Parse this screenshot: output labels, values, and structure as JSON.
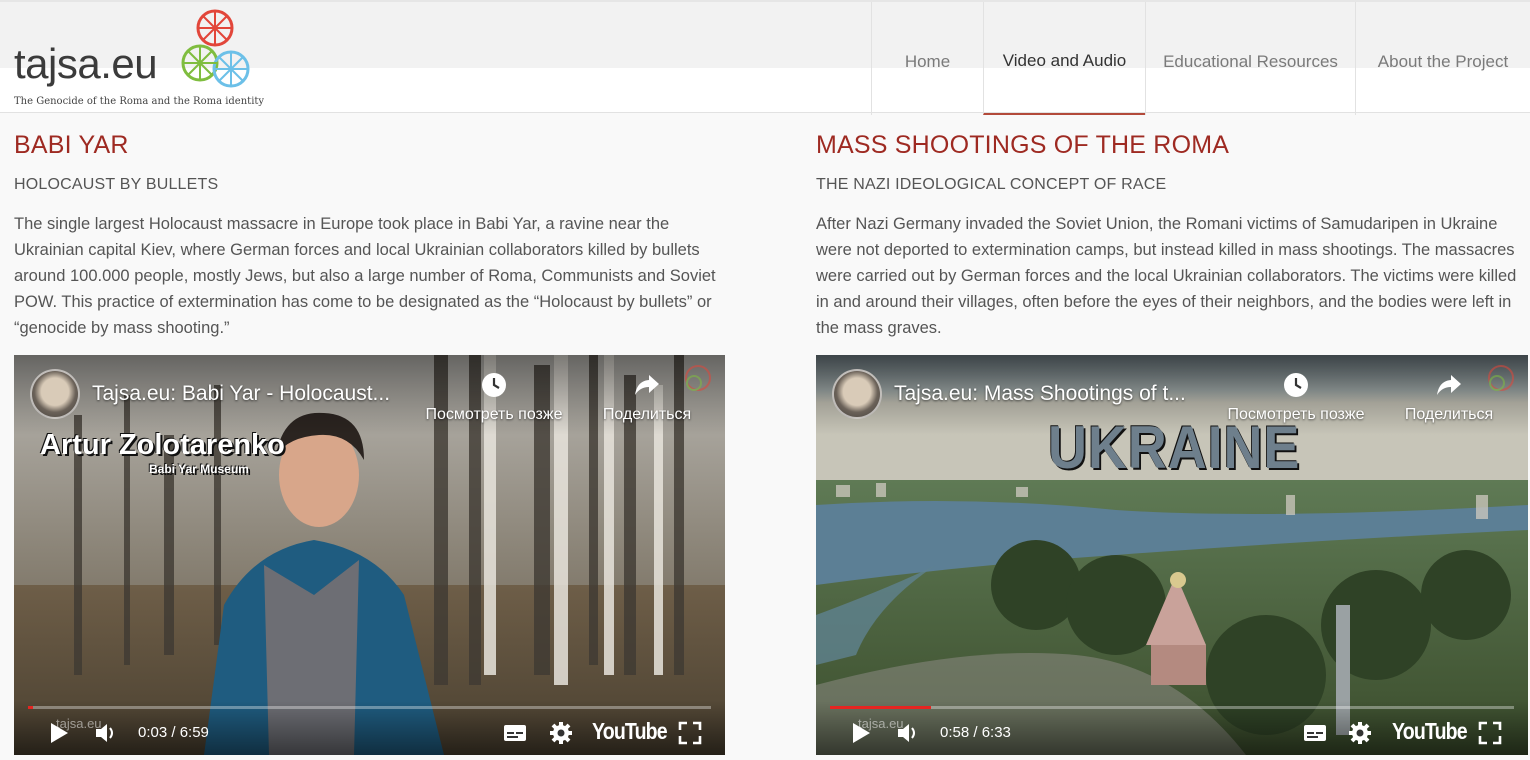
{
  "header": {
    "logo_text": "tajsa.eu",
    "logo_tagline": "The Genocide of the Roma and the Roma identity",
    "nav": [
      {
        "label": "Home",
        "active": false
      },
      {
        "label": "Video and Audio",
        "active": true
      },
      {
        "label": "Educational Resources",
        "active": false
      },
      {
        "label": "About the Project",
        "active": false
      }
    ]
  },
  "sections": [
    {
      "title": "BABI YAR",
      "subtitle": "HOLOCAUST BY BULLETS",
      "description": "The single largest Holocaust massacre in Europe took place in Babi Yar, a ravine near the Ukrainian capital Kiev, where German forces and local Ukrainian collaborators killed by bullets around 100.000 people, mostly Jews, but also a large number of Roma, Communists and Soviet POW. This practice of extermination has come to be designated as the “Holocaust by bullets” or “genocide by mass shooting.”",
      "video": {
        "title": "Tajsa.eu: Babi Yar - Holocaust...",
        "watch_later": "Посмотреть позже",
        "share": "Поделиться",
        "overlay_name": "Artur Zolotarenko",
        "overlay_role": "Babi Yar Museum",
        "watermark": "tajsa.eu",
        "time": "0:03 / 6:59",
        "progress": 0.007,
        "youtube": "YouTube"
      }
    },
    {
      "title": "MASS SHOOTINGS OF THE ROMA",
      "subtitle": "THE NAZI IDEOLOGICAL CONCEPT OF RACE",
      "description": "After Nazi Germany invaded the Soviet Union, the Romani victims of Samudaripen in Ukraine were not deported to extermination camps, but instead killed in mass shootings. The massacres were carried out by German forces and the local Ukrainian collaborators. The victims were killed in and around their villages, often before the eyes of their neighbors, and the bodies were left in the mass graves.",
      "video": {
        "title": "Tajsa.eu: Mass Shootings of t...",
        "watch_later": "Посмотреть позже",
        "share": "Поделиться",
        "overlay_caption": "UKRAINE",
        "watermark": "tajsa.eu",
        "time": "0:58 / 6:33",
        "progress": 0.147,
        "youtube": "YouTube"
      }
    }
  ],
  "colors": {
    "title_red": "#9e2a22",
    "nav_active_underline": "#b34a3a",
    "yt_progress": "#e52521"
  }
}
